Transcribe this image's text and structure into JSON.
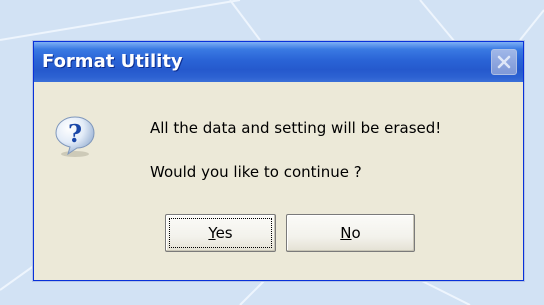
{
  "window": {
    "title": "Format Utility",
    "close_icon": "close-icon"
  },
  "message": {
    "icon": "question-icon",
    "line1": "All the data and setting will be erased!",
    "line2": "Would you like to continue ?"
  },
  "buttons": {
    "yes": {
      "mnemonic": "Y",
      "rest": "es"
    },
    "no": {
      "mnemonic": "N",
      "rest": "o"
    }
  },
  "colors": {
    "titlebar": "#2a64d6",
    "dialog_bg": "#ece9d8",
    "backdrop": "#d4e4f5"
  }
}
